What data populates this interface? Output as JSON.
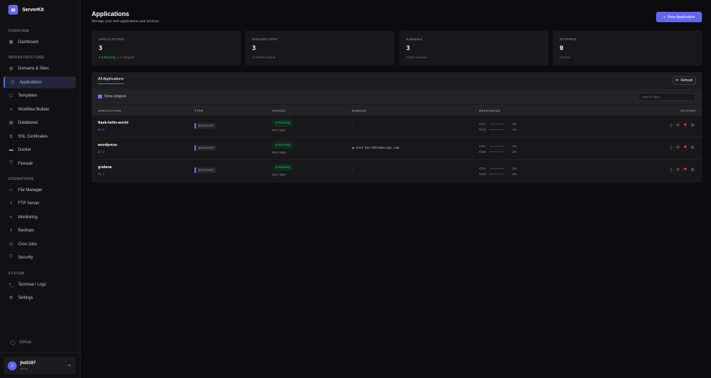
{
  "brand": "ServerKit",
  "sidebar": {
    "sections": {
      "overview": "OVERVIEW",
      "infrastructure": "INFRASTRUCTURE",
      "operations": "OPERATIONS",
      "system": "SYSTEM"
    },
    "items": [
      "Dashboard",
      "Domains & Sites",
      "Applications",
      "Templates",
      "Workflow Builder",
      "Databases",
      "SSL Certificates",
      "Docker",
      "Firewall",
      "File Manager",
      "FTP Server",
      "Monitoring",
      "Backups",
      "Cron Jobs",
      "Security",
      "Terminal / Logs",
      "Settings"
    ],
    "github": "Github",
    "user": {
      "initial": "J",
      "name": "jhd3197",
      "role": "admin"
    }
  },
  "header": {
    "title": "Applications",
    "subtitle": "Manage your web applications and services",
    "new_button": "New Application"
  },
  "stats": [
    {
      "label": "APPLICATIONS",
      "value": "3",
      "running": "3 Running",
      "stopped": "0 Stopped"
    },
    {
      "label": "DOCKER APPS",
      "value": "3",
      "sub": "Container-based"
    },
    {
      "label": "RUNNING",
      "value": "3",
      "sub": "Active services"
    },
    {
      "label": "STOPPED",
      "value": "0",
      "sub": "Inactive"
    }
  ],
  "panel": {
    "tab": "All Applications",
    "refresh": "Refresh",
    "show_stopped": "Show stopped",
    "search_placeholder": "Search apps...",
    "columns": [
      "APPLICATION",
      "TYPE",
      "STATUS",
      "DOMAIN",
      "RESOURCES",
      "ACTIONS"
    ],
    "rows": [
      {
        "name": "flask-hello-world",
        "id": "ID: 3",
        "type": "DOCKER",
        "status": "Running",
        "port": "Port: 5001",
        "domain": "-",
        "cpu_label": "CPU",
        "cpu": "0%",
        "cpu_pct": 0,
        "ram_label": "RAM",
        "ram": "2%",
        "ram_pct": 2
      },
      {
        "name": "wordpress",
        "id": "ID: 2",
        "type": "DOCKER",
        "status": "Running",
        "port": "Port: 8082",
        "domain": "test.buildthedesign.com",
        "cpu_label": "CPU",
        "cpu": "0%",
        "cpu_pct": 0,
        "ram_label": "RAM",
        "ram": "2%",
        "ram_pct": 2
      },
      {
        "name": "grafana",
        "id": "ID: 1",
        "type": "DOCKER",
        "status": "Running",
        "port": "Port: 3000",
        "domain": "-",
        "cpu_label": "CPU",
        "cpu": "0%",
        "cpu_pct": 0,
        "ram_label": "RAM",
        "ram": "2%",
        "ram_pct": 2
      }
    ]
  },
  "colors": {
    "accent": "#6366f1",
    "running": "#22c55e",
    "stop": "#ef4444"
  }
}
